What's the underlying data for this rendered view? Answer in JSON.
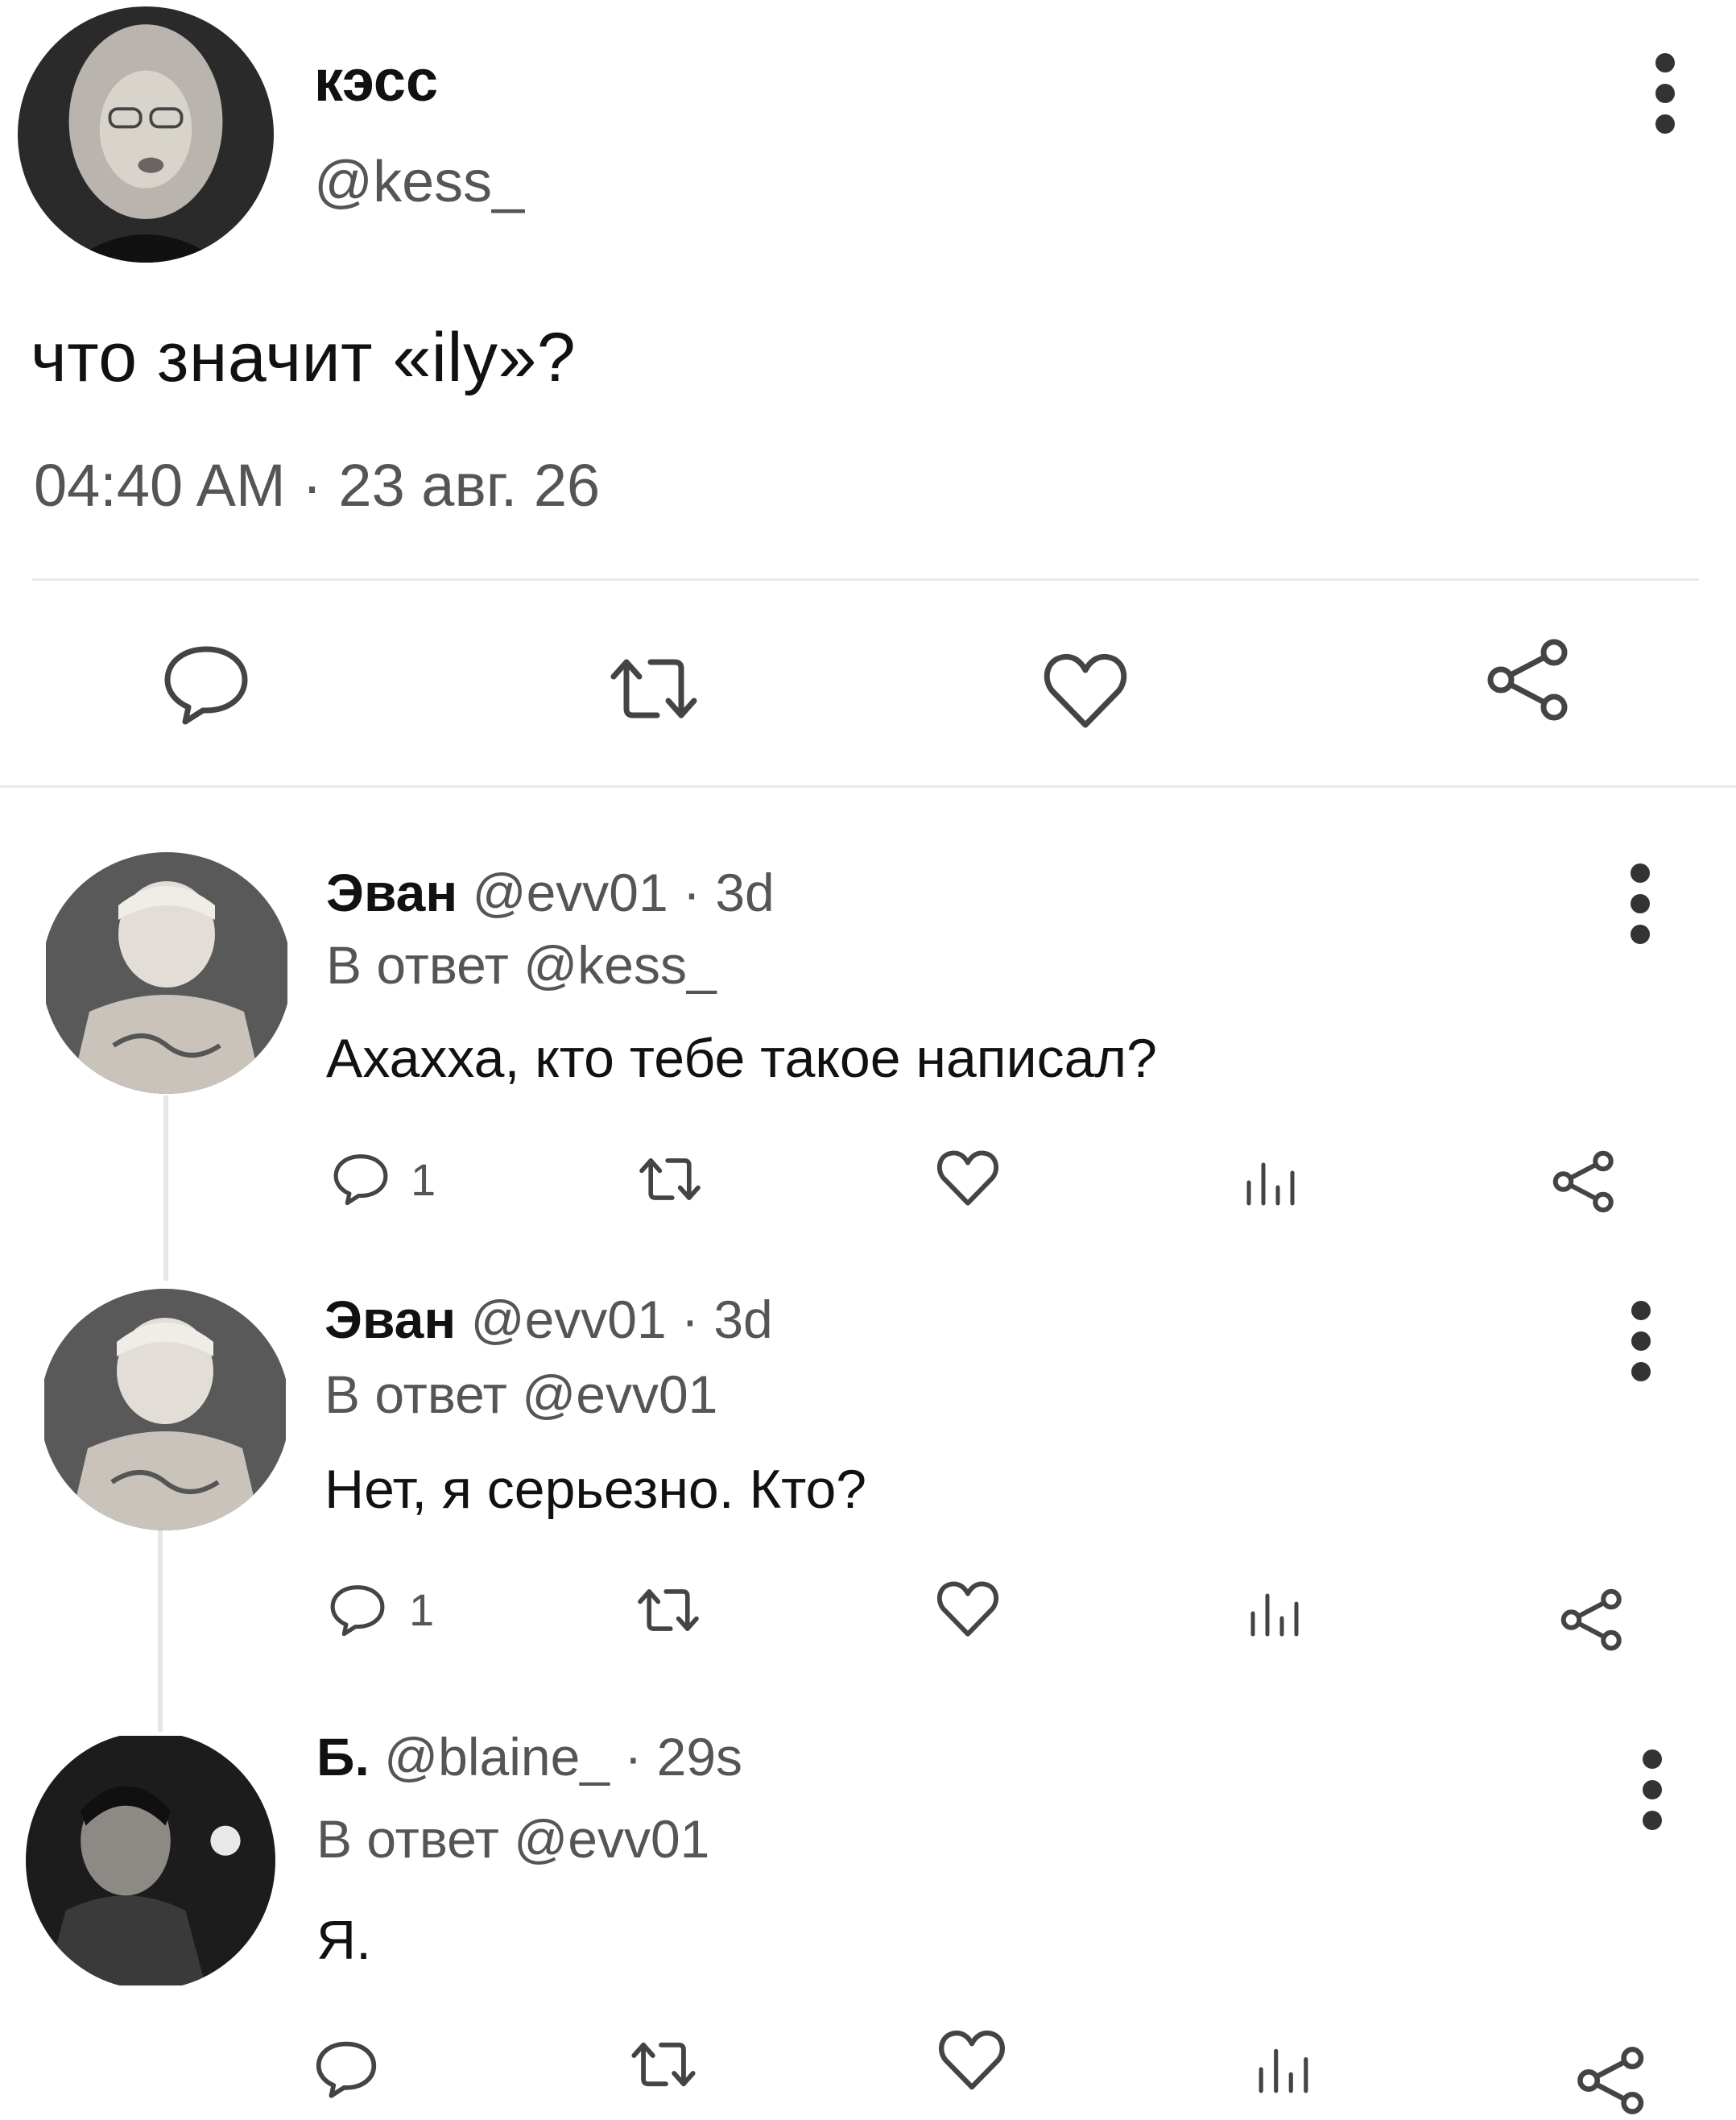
{
  "main_tweet": {
    "name": "кэсс",
    "handle": "@kess_",
    "text": "что значит «ily»?",
    "timestamp": "04:40 AM · 23 авг. 26"
  },
  "replies": [
    {
      "name": "Эван",
      "handle": "@evv01",
      "time": " · 3d",
      "reply_to": "В ответ @kess_",
      "text": "Ахахха, кто тебе такое написал?",
      "reply_count": "1"
    },
    {
      "name": "Эван",
      "handle": "@evv01",
      "time": " · 3d",
      "reply_to": "В ответ @evv01",
      "text": "Нет, я серьезно. Кто?",
      "reply_count": "1"
    },
    {
      "name": "Б.",
      "handle": "@blaine_",
      "time": " · 29s",
      "reply_to": "В ответ @evv01",
      "text": "Я.",
      "reply_count": ""
    }
  ],
  "colors": {
    "text": "#111111",
    "muted": "#555555",
    "divider": "#e8e8e8",
    "icon": "#444444"
  }
}
